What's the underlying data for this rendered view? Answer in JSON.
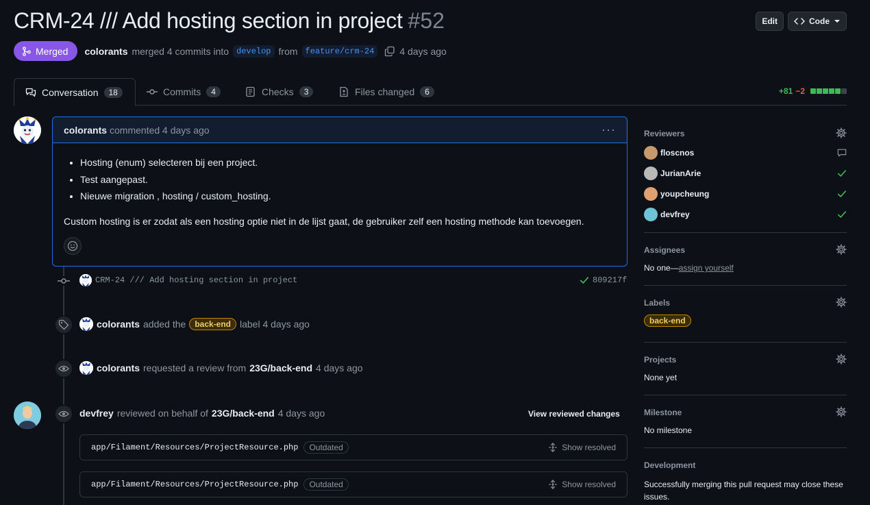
{
  "header": {
    "title": "CRM-24 /// Add hosting section in project",
    "number": "#52",
    "edit_label": "Edit",
    "code_label": "Code",
    "status": "Merged",
    "author": "colorants",
    "merged_text": "merged 4 commits into",
    "base_branch": "develop",
    "from_text": "from",
    "head_branch": "feature/crm-24",
    "time": "4 days ago"
  },
  "tabs": [
    {
      "label": "Conversation",
      "count": "18",
      "icon": "comment-discussion-icon"
    },
    {
      "label": "Commits",
      "count": "4",
      "icon": "git-commit-icon"
    },
    {
      "label": "Checks",
      "count": "3",
      "icon": "checklist-icon"
    },
    {
      "label": "Files changed",
      "count": "6",
      "icon": "file-diff-icon"
    }
  ],
  "diffstat": {
    "additions": "+81",
    "deletions": "−2",
    "blocks": [
      "#3fb950",
      "#3fb950",
      "#3fb950",
      "#3fb950",
      "#3fb950",
      "#3d444d"
    ]
  },
  "comment": {
    "author": "colorants",
    "meta": "commented 4 days ago",
    "bullets": [
      "Hosting (enum) selecteren bij een project.",
      "Test aangepast.",
      "Nieuwe migration , hosting / custom_hosting."
    ],
    "paragraph": "Custom hosting is er zodat als een hosting optie niet in de lijst gaat, de gebruiker zelf een hosting methode kan toevoegen."
  },
  "timeline": {
    "commit": {
      "message": "CRM-24 /// Add hosting section in project",
      "sha": "809217f"
    },
    "label_event": {
      "actor": "colorants",
      "pre": "added the",
      "label": "back-end",
      "post": "label 4 days ago"
    },
    "review_request": {
      "actor": "colorants",
      "text": "requested a review from",
      "team": "23G/back-end",
      "time": "4 days ago"
    },
    "review": {
      "actor": "devfrey",
      "text": "reviewed on behalf of",
      "team": "23G/back-end",
      "time": "4 days ago",
      "view_label": "View reviewed changes"
    },
    "files": [
      {
        "path": "app/Filament/Resources/ProjectResource.php",
        "badge": "Outdated",
        "action": "Show resolved"
      },
      {
        "path": "app/Filament/Resources/ProjectResource.php",
        "badge": "Outdated",
        "action": "Show resolved"
      }
    ]
  },
  "sidebar": {
    "reviewers_title": "Reviewers",
    "reviewers": [
      {
        "name": "floscnos",
        "status": "comment-icon",
        "color": "#c69a6d"
      },
      {
        "name": "JurianArie",
        "status": "check-icon",
        "color": "#b9b9b9"
      },
      {
        "name": "youpcheung",
        "status": "check-icon",
        "color": "#e0a070"
      },
      {
        "name": "devfrey",
        "status": "check-icon",
        "color": "#6fc3d6"
      }
    ],
    "assignees_title": "Assignees",
    "assignees_none": "No one—",
    "assign_link": "assign yourself",
    "labels_title": "Labels",
    "label": "back-end",
    "projects_title": "Projects",
    "projects_value": "None yet",
    "milestone_title": "Milestone",
    "milestone_value": "No milestone",
    "development_title": "Development",
    "development_value": "Successfully merging this pull request may close these issues."
  }
}
